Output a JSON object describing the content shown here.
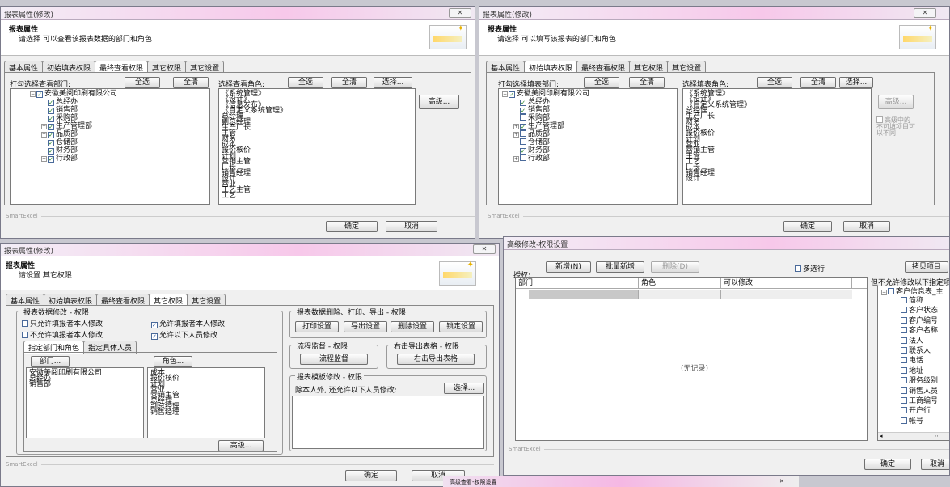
{
  "w1": {
    "title": "报表属性(修改)",
    "close": "✕",
    "header_title": "报表属性",
    "header_sub": "请选择 可以查看该报表数据的部门和角色",
    "tabs": [
      "基本属性",
      "初始填表权限",
      "最终查看权限",
      "其它权限",
      "其它设置"
    ],
    "dept_label": "打勾选择查看部门:",
    "select_all": "全选",
    "clear_all": "全清",
    "role_label": "选择查看角色:",
    "select": "选择...",
    "advanced": "高级...",
    "tree": [
      {
        "label": "安徽美阅印刷有限公司",
        "lvl": 0,
        "exp": "−",
        "chk": true
      },
      {
        "label": "总经办",
        "lvl": 1,
        "exp": "",
        "chk": true
      },
      {
        "label": "销售部",
        "lvl": 1,
        "exp": "",
        "chk": true
      },
      {
        "label": "采购部",
        "lvl": 1,
        "exp": "",
        "chk": true
      },
      {
        "label": "生产管理部",
        "lvl": 1,
        "exp": "+",
        "chk": true
      },
      {
        "label": "品质部",
        "lvl": 1,
        "exp": "+",
        "chk": true
      },
      {
        "label": "仓储部",
        "lvl": 1,
        "exp": "",
        "chk": true
      },
      {
        "label": "财务部",
        "lvl": 1,
        "exp": "",
        "chk": true
      },
      {
        "label": "行政部",
        "lvl": 1,
        "exp": "+",
        "chk": true
      }
    ],
    "roles": [
      "《系统管理》",
      "《设计》",
      "《信息发布》",
      "《自定义系统管理》",
      "总经理",
      "副总经理",
      "生产厂长",
      "主管",
      "财务",
      "成本",
      "报价核价",
      "计划",
      "营销主管",
      "厂长",
      "销售经理",
      "设计",
      "营业",
      "工艺主管",
      "工艺"
    ],
    "footer": "SmartExcel",
    "ok": "确定",
    "cancel": "取消"
  },
  "w2": {
    "title": "报表属性(修改)",
    "close": "✕",
    "header_title": "报表属性",
    "header_sub": "请选择 可以填写该报表的部门和角色",
    "tabs": [
      "基本属性",
      "初始填表权限",
      "最终查看权限",
      "其它权限",
      "其它设置"
    ],
    "dept_label": "打勾选择填表部门:",
    "select_all": "全选",
    "clear_all": "全清",
    "role_label": "选择填表角色:",
    "select": "选择...",
    "advanced": "高级...",
    "advanced_note": "高级中的不可填项目可以不同",
    "tree": [
      {
        "label": "安徽美阅印刷有限公司",
        "lvl": 0,
        "exp": "−",
        "chk": true
      },
      {
        "label": "总经办",
        "lvl": 1,
        "exp": "",
        "chk": true
      },
      {
        "label": "销售部",
        "lvl": 1,
        "exp": "",
        "chk": true
      },
      {
        "label": "采购部",
        "lvl": 1,
        "exp": "",
        "chk": false
      },
      {
        "label": "生产管理部",
        "lvl": 1,
        "exp": "+",
        "chk": true
      },
      {
        "label": "品质部",
        "lvl": 1,
        "exp": "+",
        "chk": false
      },
      {
        "label": "仓储部",
        "lvl": 1,
        "exp": "",
        "chk": false
      },
      {
        "label": "财务部",
        "lvl": 1,
        "exp": "",
        "chk": true
      },
      {
        "label": "行政部",
        "lvl": 1,
        "exp": "+",
        "chk": false
      }
    ],
    "roles": [
      "《系统管理》",
      "《设计》",
      "《自定义系统管理》",
      "总经理",
      "生产厂长",
      "财务",
      "成本",
      "报价核价",
      "计划",
      "营业",
      "营销主管",
      "主管",
      "工艺",
      "厂长",
      "销售经理",
      "设计"
    ],
    "footer": "SmartExcel",
    "ok": "确定",
    "cancel": "取消"
  },
  "w3": {
    "title": "报表属性(修改)",
    "close": "✕",
    "header_title": "报表属性",
    "header_sub": "请设置 其它权限",
    "tabs": [
      "基本属性",
      "初始填表权限",
      "最终查看权限",
      "其它权限",
      "其它设置"
    ],
    "grp_modify": "报表数据修改 - 权限",
    "opt1": "只允许填报者本人修改",
    "opt2": "不允许填报者本人修改",
    "opt3": "允许填报者本人修改",
    "opt4": "允许以下人员修改",
    "subtab1": "指定部门和角色",
    "subtab2": "指定具体人员",
    "dept_btn": "部门...",
    "role_btn": "角色...",
    "depts": [
      "安徽美阅印刷有限公司",
      "总经办",
      "销售部"
    ],
    "roles": [
      "成本",
      "报价核价",
      "计划",
      "营业",
      "营销主管",
      "总经理",
      "副总经理",
      "销售经理"
    ],
    "advanced": "高级...",
    "grp_print": "报表数据删除、打印、导出 - 权限",
    "print_set": "打印设置",
    "export_set": "导出设置",
    "delete_set": "删除设置",
    "lock_set": "锁定设置",
    "grp_flow": "流程监督 - 权限",
    "flow_btn": "流程监督",
    "grp_right_export": "右击导出表格 - 权限",
    "right_export_btn": "右击导出表格",
    "grp_template": "报表模板修改 - 权限",
    "template_text": "除本人外, 还允许以下人员修改:",
    "select": "选择...",
    "footer": "SmartExcel",
    "ok": "确定",
    "cancel": "取消",
    "taskbar": "高级查看-权限设置"
  },
  "w4": {
    "title": "高级修改-权限设置",
    "auth_label": "授权:",
    "add": "新增(N)",
    "batch_add": "批量新增",
    "delete": "删除(D)",
    "multi_select": "多选行",
    "copy_item": "拷贝项目",
    "cols": [
      "部门",
      "角色",
      "可以修改"
    ],
    "no_record": "(无记录)",
    "right_title": "但不允许修改以下指定项",
    "right_tree_root": "客户信息表_主",
    "fields": [
      "简称",
      "客户状态",
      "客户编号",
      "客户名称",
      "法人",
      "联系人",
      "电话",
      "地址",
      "服务级别",
      "销售人员",
      "工商编号",
      "开户行",
      "帐号"
    ],
    "footer": "SmartExcel",
    "ok": "确定",
    "cancel": "取消"
  }
}
